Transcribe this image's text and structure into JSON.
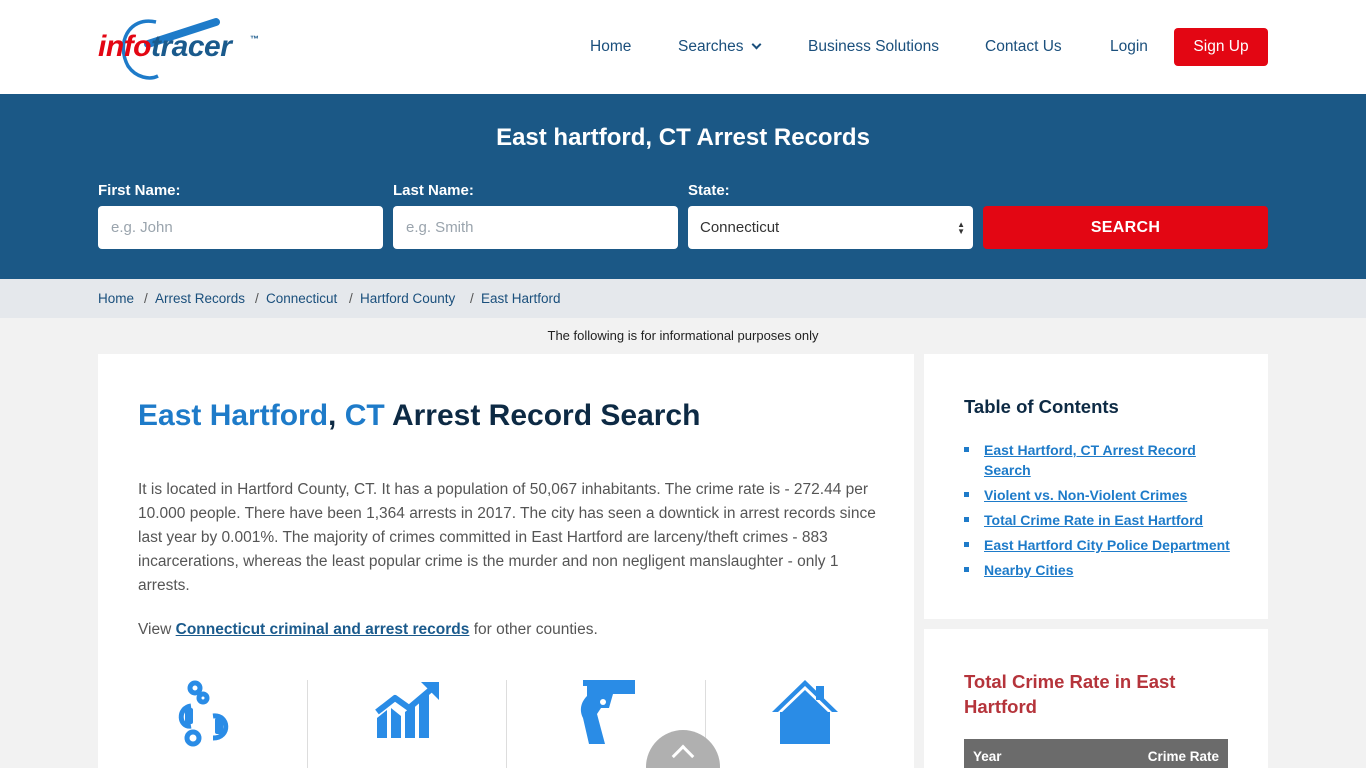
{
  "header": {
    "logo": {
      "info": "info",
      "tracer": "tracer",
      "tm": "™"
    },
    "nav": {
      "home": "Home",
      "searches": "Searches",
      "business": "Business Solutions",
      "contact": "Contact Us",
      "login": "Login",
      "signup": "Sign Up"
    }
  },
  "search_band": {
    "title": "East hartford, CT Arrest Records",
    "first_name_label": "First Name:",
    "first_name_placeholder": "e.g. John",
    "last_name_label": "Last Name:",
    "last_name_placeholder": "e.g. Smith",
    "state_label": "State:",
    "state_value": "Connecticut",
    "search_label": "SEARCH"
  },
  "breadcrumb": {
    "items": [
      "Home",
      "Arrest Records",
      "Connecticut",
      "Hartford County",
      "East Hartford"
    ],
    "separator": "/"
  },
  "info_note": "The following is for informational purposes only",
  "main": {
    "title_city": "East Hartford",
    "title_comma": ",",
    "title_state": "CT",
    "title_rest": "Arrest Record Search",
    "paragraph": "It is located in Hartford County, CT. It has a population of 50,067 inhabitants. The crime rate is - 272.44 per 10.000 people. There have been 1,364 arrests in 2017. The city has seen a downtick in arrest records since last year by 0.001%. The majority of crimes committed in East Hartford are larceny/theft crimes - 883 incarcerations, whereas the least popular crime is the murder and non negligent manslaughter - only 1 arrests.",
    "view_prefix": "View",
    "view_link": "Connecticut criminal and arrest records",
    "view_suffix": "for other counties.",
    "stat_icons": [
      "handcuffs-icon",
      "chart-growth-icon",
      "gun-icon",
      "house-icon"
    ]
  },
  "toc": {
    "title": "Table of Contents",
    "items": [
      "East Hartford, CT Arrest Record Search",
      "Violent vs. Non-Violent Crimes",
      "Total Crime Rate in East Hartford",
      "East Hartford City Police Department",
      "Nearby Cities"
    ]
  },
  "crime_rate": {
    "title": "Total Crime Rate in East Hartford",
    "col_year": "Year",
    "col_rate": "Crime Rate"
  },
  "colors": {
    "brand_blue": "#1b5886",
    "accent_red": "#e30613",
    "link_blue": "#1e7bc9",
    "icon_blue": "#2a8ce6"
  }
}
